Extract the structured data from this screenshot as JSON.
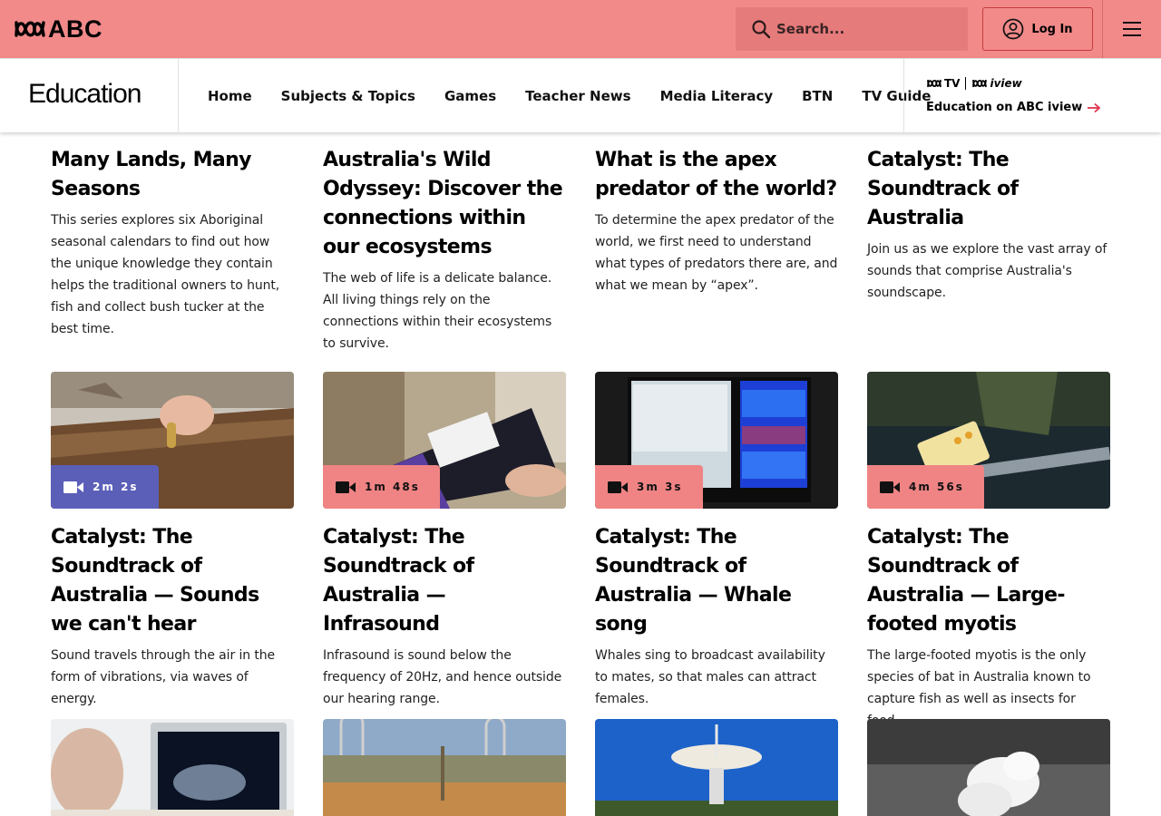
{
  "header": {
    "brand": "ABC",
    "search_placeholder": "Search...",
    "login_label": "Log In"
  },
  "section": {
    "title": "Education",
    "nav": [
      "Home",
      "Subjects & Topics",
      "Games",
      "Teacher News",
      "Media Literacy",
      "BTN",
      "TV Guide"
    ],
    "iview_logo_a": "TV",
    "iview_logo_b": "iview",
    "iview_link": "Education on ABC iview"
  },
  "colors": {
    "topbar": "#f28a8a",
    "badge_pink": "#f08484",
    "badge_purple": "#5b5fb8",
    "accent_arrow": "#e0334c"
  },
  "row1": [
    {
      "title": "Many Lands, Many Seasons",
      "desc": "This series explores six Aboriginal seasonal calendars to find out how the unique knowledge they contain helps the traditional owners to hunt, fish and collect bush tucker at the best time."
    },
    {
      "title": "Australia's Wild Odyssey: Discover the connections within our ecosystems",
      "desc": "The web of life is a delicate balance. All living things rely on the connections within their ecosystems to survive."
    },
    {
      "title": "What is the apex predator of the world?",
      "desc": "To determine the apex predator of the world, we first need to understand what types of predators there are, and what we mean by “apex”."
    },
    {
      "title": "Catalyst: The Soundtrack of Australia",
      "desc": "Join us as we explore the vast array of sounds that comprise Australia's soundscape."
    }
  ],
  "row2": [
    {
      "duration": "2m 2s",
      "badge": "purple",
      "icon": "video-camera-icon",
      "title": "Catalyst: The Soundtrack of Australia — Sounds we can't hear",
      "desc": "Sound travels through the air in the form of vibrations, via waves of energy."
    },
    {
      "duration": "1m 48s",
      "badge": "pink",
      "icon": "video-camera-icon",
      "title": "Catalyst: The Soundtrack of Australia — Infrasound",
      "desc": "Infrasound is sound below the frequency of 20Hz, and hence outside our hearing range."
    },
    {
      "duration": "3m 3s",
      "badge": "pink",
      "icon": "video-camera-icon",
      "title": "Catalyst: The Soundtrack of Australia — Whale song",
      "desc": "Whales sing to broadcast availability to mates, so that males can attract females."
    },
    {
      "duration": "4m 56s",
      "badge": "pink",
      "icon": "video-camera-icon",
      "title": "Catalyst: The Soundtrack of Australia — Large-footed myotis",
      "desc": "The large-footed myotis is the only species of bat in Australia known to capture fish as well as insects for food."
    }
  ]
}
